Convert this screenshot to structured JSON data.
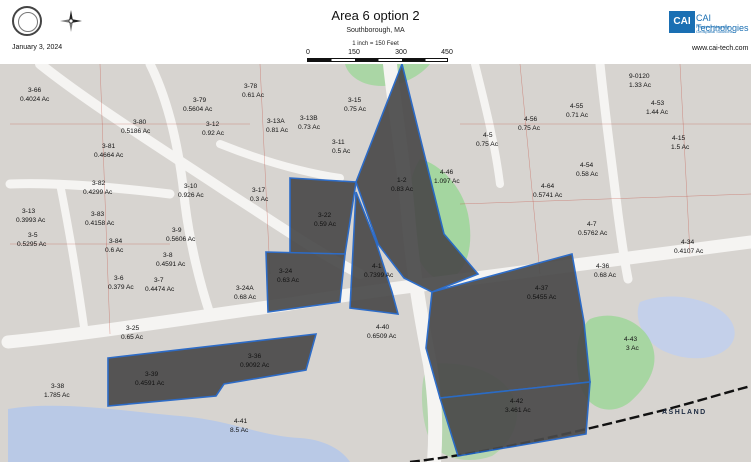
{
  "header": {
    "title": "Area 6 option 2",
    "subtitle": "Southborough, MA",
    "scale_text": "1 inch = 150 Feet",
    "scale_ticks": [
      "0",
      "150",
      "300",
      "450"
    ],
    "date": "January 3, 2024",
    "logo_text": "CAI Technologies",
    "logo_box": "CAI",
    "logo_tagline": "Precision Mapping. Geospatial Solutions.",
    "website": "www.cai-tech.com"
  },
  "colors": {
    "highlight_fill": "#4a4a4a",
    "highlight_outline": "#1f63c6",
    "water": "#b9c9e6",
    "wetland": "#9fd69a"
  },
  "map": {
    "place_label": "ASHLAND",
    "parcels": [
      {
        "id": "3-66",
        "area": "0.4024 Ac"
      },
      {
        "id": "3-79",
        "area": "0.5604 Ac"
      },
      {
        "id": "3-78",
        "area": "0.61 Ac"
      },
      {
        "id": "3-15",
        "area": "0.75 Ac"
      },
      {
        "id": "3-80",
        "area": "0.5186 Ac"
      },
      {
        "id": "3-13A",
        "area": "0.81 Ac"
      },
      {
        "id": "3-13B",
        "area": "0.73 Ac"
      },
      {
        "id": "3-12",
        "area": "0.92 Ac"
      },
      {
        "id": "3-81",
        "area": "0.4664 Ac"
      },
      {
        "id": "3-11",
        "area": "0.5 Ac"
      },
      {
        "id": "3-82",
        "area": "0.4299 Ac"
      },
      {
        "id": "3-10",
        "area": "0.926 Ac"
      },
      {
        "id": "3-17",
        "area": "0.3 Ac"
      },
      {
        "id": "3-13",
        "area": "0.3993 Ac"
      },
      {
        "id": "3-83",
        "area": "0.4158 Ac"
      },
      {
        "id": "3-22",
        "area": "0.59 Ac"
      },
      {
        "id": "3-5",
        "area": "0.5295 Ac"
      },
      {
        "id": "3-9",
        "area": "0.5606 Ac"
      },
      {
        "id": "3-84",
        "area": "0.6 Ac"
      },
      {
        "id": "3-8",
        "area": "0.4591 Ac"
      },
      {
        "id": "3-24",
        "area": "0.63 Ac"
      },
      {
        "id": "3-6",
        "area": "0.379 Ac"
      },
      {
        "id": "3-7",
        "area": "0.4474 Ac"
      },
      {
        "id": "3-24A",
        "area": "0.68 Ac"
      },
      {
        "id": "3-25",
        "area": "0.65 Ac"
      },
      {
        "id": "3-36",
        "area": "0.9092 Ac"
      },
      {
        "id": "3-38",
        "area": "1.785 Ac"
      },
      {
        "id": "3-39",
        "area": "0.4591 Ac"
      },
      {
        "id": "4-41",
        "area": "8.5 Ac"
      },
      {
        "id": "1-2",
        "area": "0.83 Ac"
      },
      {
        "id": "4-1",
        "area": "0.7399 Ac"
      },
      {
        "id": "4-40",
        "area": "0.6509 Ac"
      },
      {
        "id": "4-46",
        "area": "1.097 Ac"
      },
      {
        "id": "4-5",
        "area": "0.75 Ac"
      },
      {
        "id": "4-56",
        "area": "0.75 Ac"
      },
      {
        "id": "4-55",
        "area": "0.71 Ac"
      },
      {
        "id": "9-0120",
        "area": "1.33 Ac"
      },
      {
        "id": "4-53",
        "area": "1.44 Ac"
      },
      {
        "id": "4-15",
        "area": "1.5 Ac"
      },
      {
        "id": "4-54",
        "area": "0.58 Ac"
      },
      {
        "id": "4-64",
        "area": "0.5741 Ac"
      },
      {
        "id": "4-7",
        "area": "0.5762 Ac"
      },
      {
        "id": "4-34",
        "area": "0.4107 Ac"
      },
      {
        "id": "4-36",
        "area": "0.68 Ac"
      },
      {
        "id": "4-37",
        "area": "0.5455 Ac"
      },
      {
        "id": "4-43",
        "area": "3 Ac"
      },
      {
        "id": "4-42",
        "area": "3.461 Ac"
      }
    ]
  }
}
